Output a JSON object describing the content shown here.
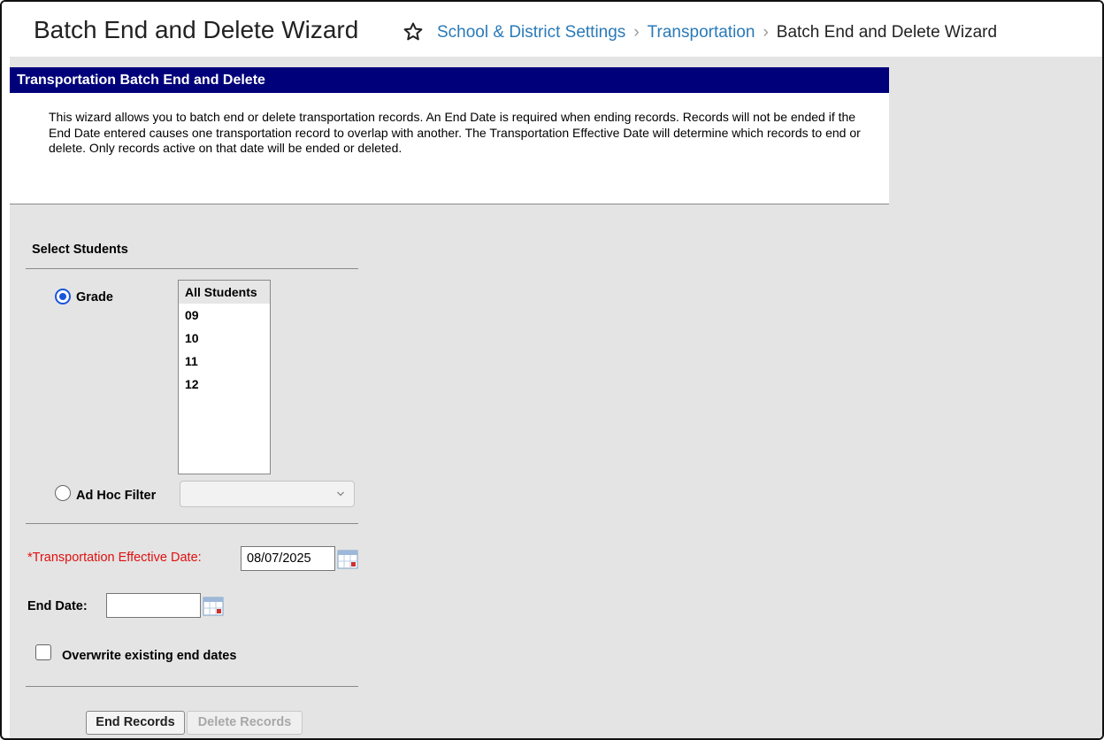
{
  "header": {
    "title": "Batch End and Delete Wizard",
    "breadcrumbs": [
      {
        "label": "School & District Settings",
        "link": true
      },
      {
        "label": "Transportation",
        "link": true
      },
      {
        "label": "Batch End and Delete Wizard",
        "link": false
      }
    ],
    "favorite_icon": "star-outline-icon"
  },
  "panel": {
    "title": "Transportation Batch End and Delete",
    "description": "This wizard allows you to batch end or delete transportation records. An End Date is required when ending records. Records will not be ended if the End Date entered causes one transportation record to overlap with another. The Transportation Effective Date will determine which records to end or delete. Only records active on that date will be ended or deleted."
  },
  "select_students": {
    "title": "Select Students",
    "grade_label": "Grade",
    "grade_selected": true,
    "grades": [
      "All Students",
      "09",
      "10",
      "11",
      "12"
    ],
    "selected_grade": "All Students",
    "adhoc_label": "Ad Hoc Filter",
    "adhoc_selected": false,
    "adhoc_value": ""
  },
  "dates": {
    "effective_label": "*Transportation Effective Date:",
    "effective_value": "08/07/2025",
    "end_label": "End Date:",
    "end_value": ""
  },
  "overwrite": {
    "label": "Overwrite existing end dates",
    "checked": false
  },
  "buttons": {
    "end_records": "End Records",
    "delete_records": "Delete Records"
  },
  "colors": {
    "panel_header": "#00007a",
    "link": "#2a7ab8",
    "required": "#e01010",
    "background": "#e4e4e4"
  }
}
